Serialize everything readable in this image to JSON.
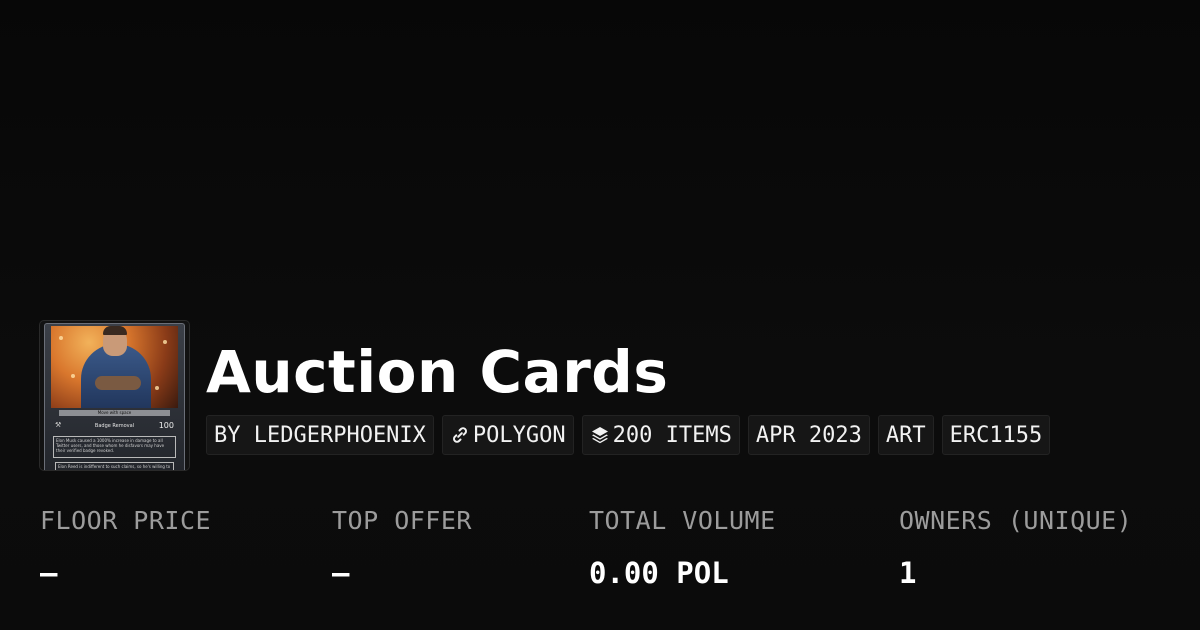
{
  "collection": {
    "title": "Auction Cards",
    "thumbnail": {
      "caption": "Move with space",
      "card_title": "Badge Removal",
      "card_value": "100",
      "card_text": "Elon Musk caused a 1000% increase in damage to all Twitter users, and those whom he disfavors may have their verified badge revoked.",
      "card_text_2": "Elon Reed is indifferent to such claims, so he's willing to"
    }
  },
  "tags": [
    {
      "label": "BY LEDGERPHOENIX",
      "icon": ""
    },
    {
      "label": "POLYGON",
      "icon": "polygon-link-icon"
    },
    {
      "label": "200 ITEMS",
      "icon": "layers-icon"
    },
    {
      "label": "APR 2023",
      "icon": ""
    },
    {
      "label": "ART",
      "icon": ""
    },
    {
      "label": "ERC1155",
      "icon": ""
    }
  ],
  "stats": {
    "floor_price": {
      "label": "FLOOR PRICE",
      "value": "–"
    },
    "top_offer": {
      "label": "TOP OFFER",
      "value": "–"
    },
    "total_volume": {
      "label": "TOTAL VOLUME",
      "value": "0.00 POL"
    },
    "owners": {
      "label": "OWNERS (UNIQUE)",
      "value": "1"
    }
  },
  "colors": {
    "background": "#0b0b0b",
    "tag_background": "#161616",
    "label_gray": "#9c9c9c",
    "text_white": "#ffffff"
  }
}
